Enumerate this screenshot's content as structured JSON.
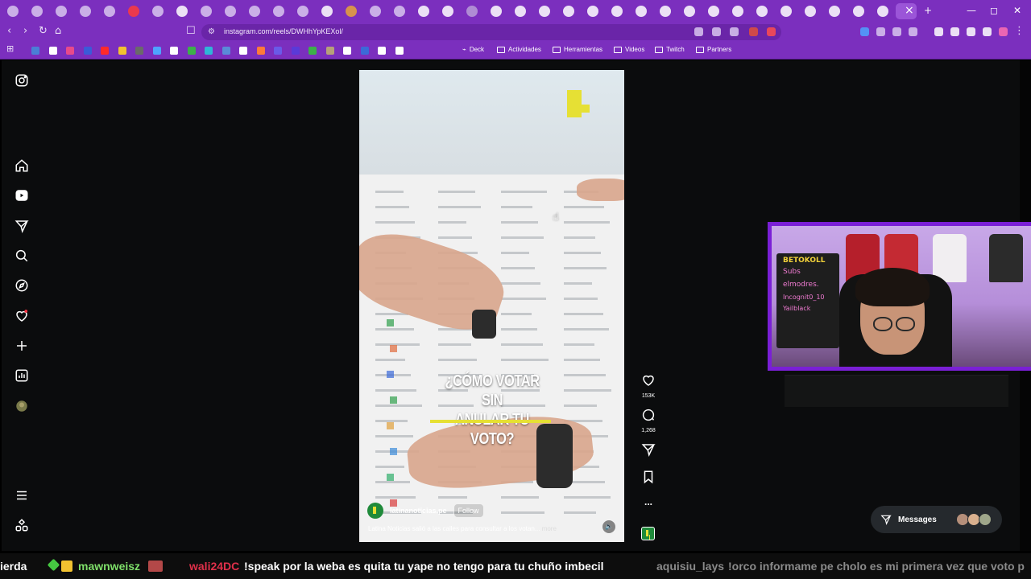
{
  "browser": {
    "url": "instagram.com/reels/DWHhYpKEXol/",
    "window_controls": [
      "—",
      "◻",
      "✕"
    ],
    "new_tab": "+",
    "close_tab": "×"
  },
  "bookmarks": {
    "items": [
      "Deck",
      "Actividades",
      "Herramientas",
      "Videos",
      "Twitch",
      "Partners"
    ]
  },
  "reel": {
    "headline_line1": "¿CÓMO VOTAR SIN",
    "headline_line2": "ANULAR TU VOTO?",
    "author": "latinanoticias.pe",
    "follow_label": "Follow",
    "caption": "Latina Noticias salió a las calles para consultar a los votan...",
    "more_label": "more",
    "likes": "153K",
    "comments": "1,268",
    "more_options": "..."
  },
  "webcam": {
    "board_lines": [
      "BETOKOLL",
      "Subs",
      "elmodres.",
      "Incognit0_10",
      "Yailblack"
    ]
  },
  "messages": {
    "label": "Messages"
  },
  "chat_ticker": {
    "seg1": "ierda",
    "seg2_user": "mawnweisz",
    "seg3_user": "wali24DC",
    "seg3_msg": "!speak por la weba es quita tu yape no tengo para tu chuño imbecil",
    "seg4_user": "aquisiu_lays",
    "seg4_msg": "!orco informame pe cholo es mi primera vez que voto p"
  },
  "colors": {
    "browser_chrome": "#7b2fbe",
    "page_bg": "#0b0c0d",
    "accent_yellow": "#e6e034",
    "webcam_border": "#7a1fd6"
  }
}
